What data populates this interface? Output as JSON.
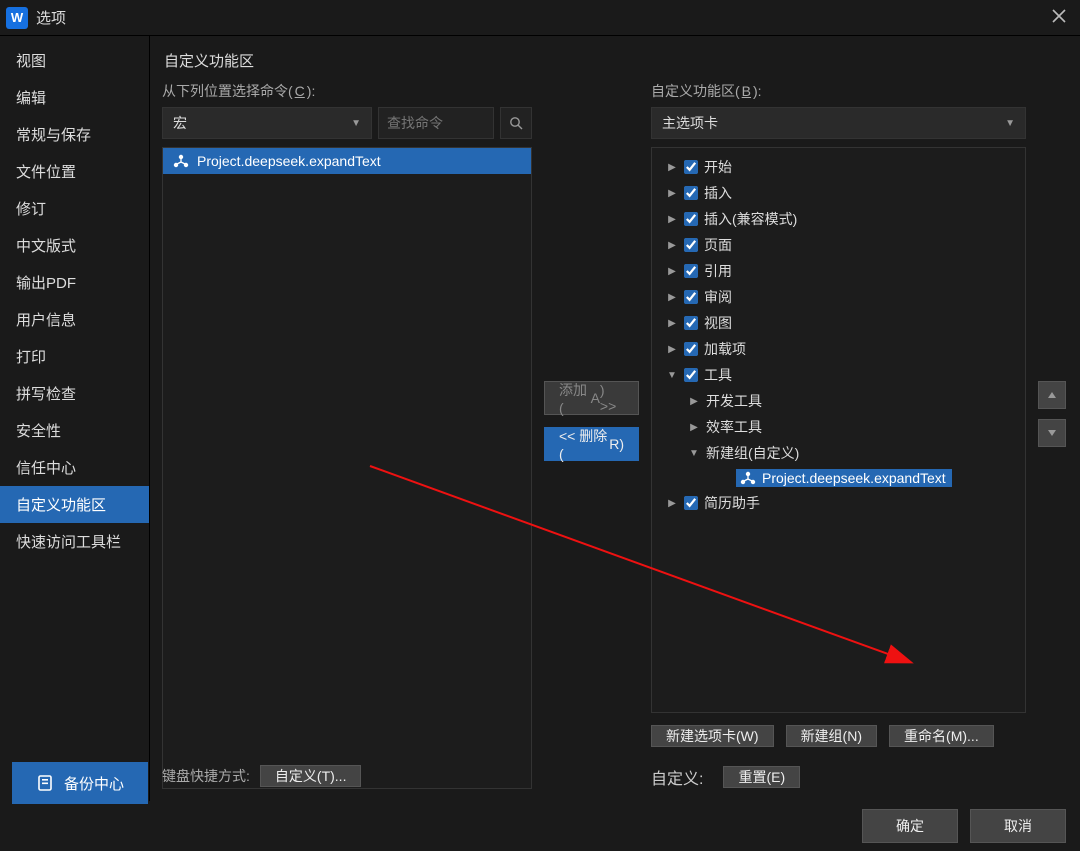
{
  "window": {
    "title": "选项",
    "app_icon": "W"
  },
  "sidebar": {
    "items": [
      {
        "label": "视图"
      },
      {
        "label": "编辑"
      },
      {
        "label": "常规与保存"
      },
      {
        "label": "文件位置"
      },
      {
        "label": "修订"
      },
      {
        "label": "中文版式"
      },
      {
        "label": "输出PDF"
      },
      {
        "label": "用户信息"
      },
      {
        "label": "打印"
      },
      {
        "label": "拼写检查"
      },
      {
        "label": "安全性"
      },
      {
        "label": "信任中心"
      },
      {
        "label": "自定义功能区",
        "selected": true
      },
      {
        "label": "快速访问工具栏"
      }
    ],
    "backup": "备份中心"
  },
  "main": {
    "title": "自定义功能区",
    "left": {
      "label_pre": "从下列位置选择命令(",
      "label_u": "C",
      "label_post": "):",
      "dropdown": "宏",
      "search_placeholder": "查找命令",
      "items": [
        {
          "label": "Project.deepseek.expandText",
          "selected": true
        }
      ]
    },
    "mid": {
      "add_pre": "添加(",
      "add_u": "A",
      "add_post": ") >>",
      "del_pre": "<< 删除(",
      "del_u": "R",
      "del_post": ")"
    },
    "right": {
      "label_pre": "自定义功能区(",
      "label_u": "B",
      "label_post": "):",
      "dropdown": "主选项卡",
      "tree": [
        {
          "level": 0,
          "expand": "▶",
          "check": true,
          "label": "开始"
        },
        {
          "level": 0,
          "expand": "▶",
          "check": true,
          "label": "插入"
        },
        {
          "level": 0,
          "expand": "▶",
          "check": true,
          "label": "插入(兼容模式)"
        },
        {
          "level": 0,
          "expand": "▶",
          "check": true,
          "label": "页面"
        },
        {
          "level": 0,
          "expand": "▶",
          "check": true,
          "label": "引用"
        },
        {
          "level": 0,
          "expand": "▶",
          "check": true,
          "label": "审阅"
        },
        {
          "level": 0,
          "expand": "▶",
          "check": true,
          "label": "视图"
        },
        {
          "level": 0,
          "expand": "▶",
          "check": true,
          "label": "加载项"
        },
        {
          "level": 0,
          "expand": "▼",
          "check": true,
          "label": "工具"
        },
        {
          "level": 1,
          "expand": "▶",
          "label": "开发工具"
        },
        {
          "level": 1,
          "expand": "▶",
          "label": "效率工具"
        },
        {
          "level": 1,
          "expand": "▼",
          "label": "新建组(自定义)"
        },
        {
          "level": 2,
          "icon": "macro",
          "label": "Project.deepseek.expandText",
          "selected": true
        },
        {
          "level": 0,
          "expand": "▶",
          "check": true,
          "label": "简历助手"
        }
      ],
      "btn_newtab_pre": "新建选项卡(",
      "btn_newtab_u": "W",
      "btn_newtab_post": ")",
      "btn_newgrp_pre": "新建组(",
      "btn_newgrp_u": "N",
      "btn_newgrp_post": ")",
      "btn_rename_pre": "重命名(",
      "btn_rename_u": "M",
      "btn_rename_post": ")...",
      "cust_label": "自定义:",
      "btn_reset_pre": "重置(",
      "btn_reset_u": "E",
      "btn_reset_post": ")"
    },
    "bottom_left": {
      "label": "键盘快捷方式:",
      "btn_pre": "自定义(",
      "btn_u": "T",
      "btn_post": ")..."
    }
  },
  "footer": {
    "ok": "确定",
    "cancel": "取消"
  }
}
